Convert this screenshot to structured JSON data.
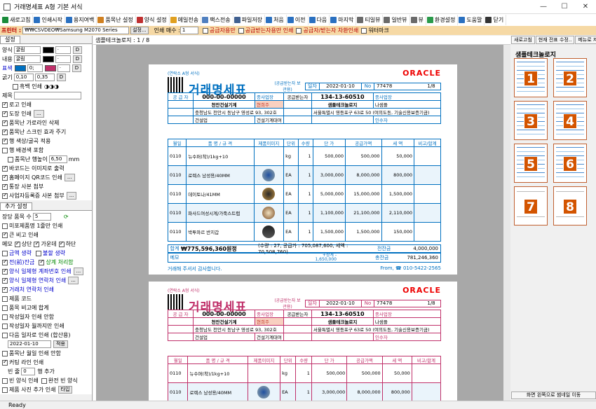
{
  "window": {
    "title": "거래명세표  A형 기본 서식"
  },
  "toolbar": [
    "새로고침",
    "인쇄시작",
    "용지여백",
    "품목난 설정",
    "양식 설정",
    "메일전송",
    "팩스전송",
    "파일저장",
    "처음",
    "이전",
    "다음",
    "마지막",
    "티일뷰",
    "일반뷰",
    "뷰",
    "환경설정",
    "도움말",
    "닫기"
  ],
  "optbar": {
    "label": "프린터 :",
    "printer": "₩₩CSVDEO₩Samsung M2070 Series",
    "setup": "설정...",
    "copies_label": "인쇄 매수 :",
    "copies": "1",
    "opt1": "공급자용만",
    "opt2": "공급받는자용만 인쇄",
    "opt3": "공급자/받는자 차환인쇄",
    "opt4": "워터마크"
  },
  "left": {
    "tab": "설정",
    "rows": [
      {
        "label": "양식",
        "font": "굴림",
        "val": "D"
      },
      {
        "label": "내용",
        "font": "굴림",
        "val": "D"
      },
      {
        "label": "표색",
        "font": "0;",
        "val": "D"
      }
    ],
    "thick_label": "굵기",
    "thick1": "0,10",
    "thick2": "0,35",
    "black_print": "흑백 인쇄",
    "title_label": "제목",
    "checks": [
      "로고 인쇄",
      "도장 인쇄",
      "품목난 가로라인 삭제",
      "품목난 스크린 효과 주기",
      "행 색상/굴곡 적용",
      "행 배경색 포함",
      "품목난 행높이",
      "바코드는 이미지로 출력",
      "홈페이지 QR코드 인쇄",
      "통장 사본 첨부",
      "사업자등록증 사본 첨부"
    ],
    "row_height": "6,50",
    "row_unit": "mm",
    "tab2": "추가 설정",
    "page_count_label": "장당 품목 수",
    "page_count": "5",
    "checks2": [
      "미포제품명 1줄만 인쇄",
      "큰 비고 인쇄"
    ],
    "memo_label": "메모",
    "memo_opts": [
      "상단",
      "가운데",
      "하단"
    ],
    "sum_items": [
      "금액 생략",
      "불할 생략",
      "전(前)잔금",
      "상계 처리함",
      "양식 일체형 계좌번호 인쇄",
      "양식 일체형 연락처 인쇄",
      "거래처 연락처 인쇄"
    ],
    "checks3": [
      "제품 코드",
      "품목 비고에 합계",
      "작성일자 인쇄 안함",
      "작성일자 월까지만 인쇄",
      "다음 일자로 인쇄 (합산용)"
    ],
    "date": "2022-01-10",
    "apply": "적용",
    "checks4": [
      "품목난 월일 인쇄 안함",
      "커팅 라인 인쇄",
      "빈 줄",
      "행 추가",
      "빈 양식 인쇄",
      "완전 빈 양식",
      "제품 사진 추가 인쇄",
      "타입"
    ],
    "blank_rows": "0"
  },
  "center": {
    "header": "샘플테크놀로지 : 1 / 8",
    "doc": {
      "small_top": "(연락소 A형 서식)",
      "title": "거래명세표",
      "sub": "(공급받는자 보관용)",
      "date_label": "일자",
      "date": "2022-01-10",
      "no_label": "No",
      "no": "77478",
      "page": "1/8",
      "oracle": "ORACLE",
      "supplier_label": "공 급 자",
      "supplier_no": "000-00-00000",
      "receiver_label": "공급받는자",
      "receiver_no": "134-13-60510",
      "biz_label": "종사업장",
      "sup_name": "천안건설기계",
      "sup_rep": "현희주",
      "rec_name": "샘플테크놀로지",
      "rec_rep": "나샘플",
      "sup_addr": "충청남도 천안시 동남구 영성로 93, 302호",
      "rec_addr": "서울특별시 영등포구 63로 50 (여의도동, 기술신용보증기금)",
      "sup_type": "건설업",
      "sup_item": "건설기계대여",
      "seal": "인수자",
      "item_headers": [
        "월일",
        "품 명 / 규 격",
        "제품이미지",
        "단위",
        "수량",
        "단 가",
        "공급가액",
        "세 액",
        "비고/합계"
      ],
      "items": [
        {
          "date": "0110",
          "name": "뉴수퍼(착)/1kg+10",
          "unit": "kg",
          "qty": "1",
          "price": "500,000",
          "amt": "500,000",
          "tax": "50,000",
          "img": ""
        },
        {
          "date": "0110",
          "name": "로렉스 남성용/40MM",
          "unit": "EA",
          "qty": "1",
          "price": "3,000,000",
          "amt": "8,000,000",
          "tax": "800,000",
          "img": "watch-blue"
        },
        {
          "date": "0110",
          "name": "데이토나/41MM",
          "unit": "EA",
          "qty": "1",
          "price": "5,000,000",
          "amt": "15,000,000",
          "tax": "1,500,000",
          "img": "watch-gold"
        },
        {
          "date": "0110",
          "name": "파사드여성시계/가죽스트랩",
          "unit": "EA",
          "qty": "1",
          "price": "1,100,000",
          "amt": "21,100,000",
          "tax": "2,110,000",
          "img": "watch-leather"
        },
        {
          "date": "0110",
          "name": "박투와르 반지갑",
          "unit": "EA",
          "qty": "1",
          "price": "1,500,000",
          "amt": "1,500,000",
          "tax": "150,000",
          "img": "wallet"
        }
      ],
      "total_label": "합계",
      "total": "₩775,596,360원정",
      "total_detail": "(수량 : 27, 공급가 : 705,087,600, 세액 : 70,508,760)",
      "prev_label": "전잔금",
      "prev": "4,000,000",
      "memo_label": "메모",
      "plus": "+상계 -",
      "plus_val": "1,650,000",
      "bal_label": "총잔금",
      "bal": "781,246,360",
      "footer_left": "거래해 주셔서 감사합니다.",
      "footer_right": "From, ☎ 010-5422-2565"
    }
  },
  "right": {
    "tabs": [
      "새로고침",
      "현재 전표 수정..",
      "메뉴로 저장.."
    ],
    "title": "샘플테크놀로지",
    "thumbs": [
      "1",
      "2",
      "3",
      "4",
      "5",
      "6",
      "7",
      "8"
    ],
    "bottom": "화면 왼쪽으로 썸네일 이동"
  },
  "status": "Ready",
  "colors": {
    "accent": "#0070c0",
    "accent2": "#d35400",
    "pink": "#c0306a",
    "optbar": "#f6d9a5"
  }
}
